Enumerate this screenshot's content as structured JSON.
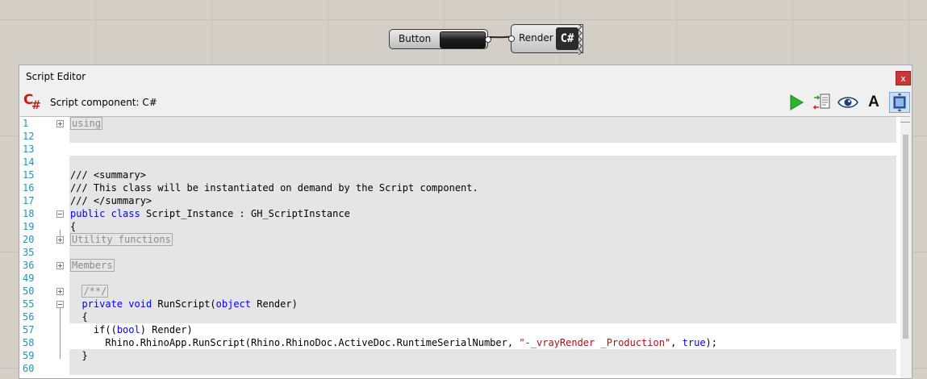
{
  "canvas": {
    "button_node": {
      "label": "Button"
    },
    "render_node": {
      "label": "Render",
      "icon": "csharp-icon"
    }
  },
  "editor": {
    "window_title": "Script Editor",
    "close_label": "x",
    "toolbar": {
      "title": "Script component: C#",
      "logo": "csharp-logo-icon",
      "font_button_label": "A",
      "icons": [
        "run-icon",
        "insert-code-icon",
        "preview-icon",
        "font-icon",
        "fit-window-icon"
      ]
    },
    "code": {
      "line_numbers": [
        "1",
        "12",
        "13",
        "14",
        "15",
        "16",
        "17",
        "18",
        "19",
        "20",
        "35",
        "36",
        "49",
        "50",
        "55",
        "56",
        "57",
        "58",
        "59",
        "60"
      ],
      "collapsed": {
        "using": "using",
        "utility": "Utility functions",
        "members": "Members",
        "doc": "/**/"
      },
      "summary_open": "/// <summary>",
      "summary_text": "/// This class will be instantiated on demand by the Script component.",
      "summary_close": "/// </summary>",
      "kw_public": "public",
      "kw_class": "class",
      "class_rest": "Script_Instance : GH_ScriptInstance",
      "brace_open": "{",
      "brace_close": "}",
      "kw_private": "private",
      "kw_void": "void",
      "method_name": "RunScript(",
      "kw_object": "object",
      "method_param": "Render)",
      "if_start": "if((",
      "kw_bool": "bool",
      "if_end": ") Render)",
      "call_start": "Rhino.RhinoApp.RunScript(Rhino.RhinoDoc.ActiveDoc.RuntimeSerialNumber,",
      "call_string": "\"-_vrayRender _Production\"",
      "comma": ",",
      "kw_true": "true",
      "call_end": ");"
    }
  }
}
